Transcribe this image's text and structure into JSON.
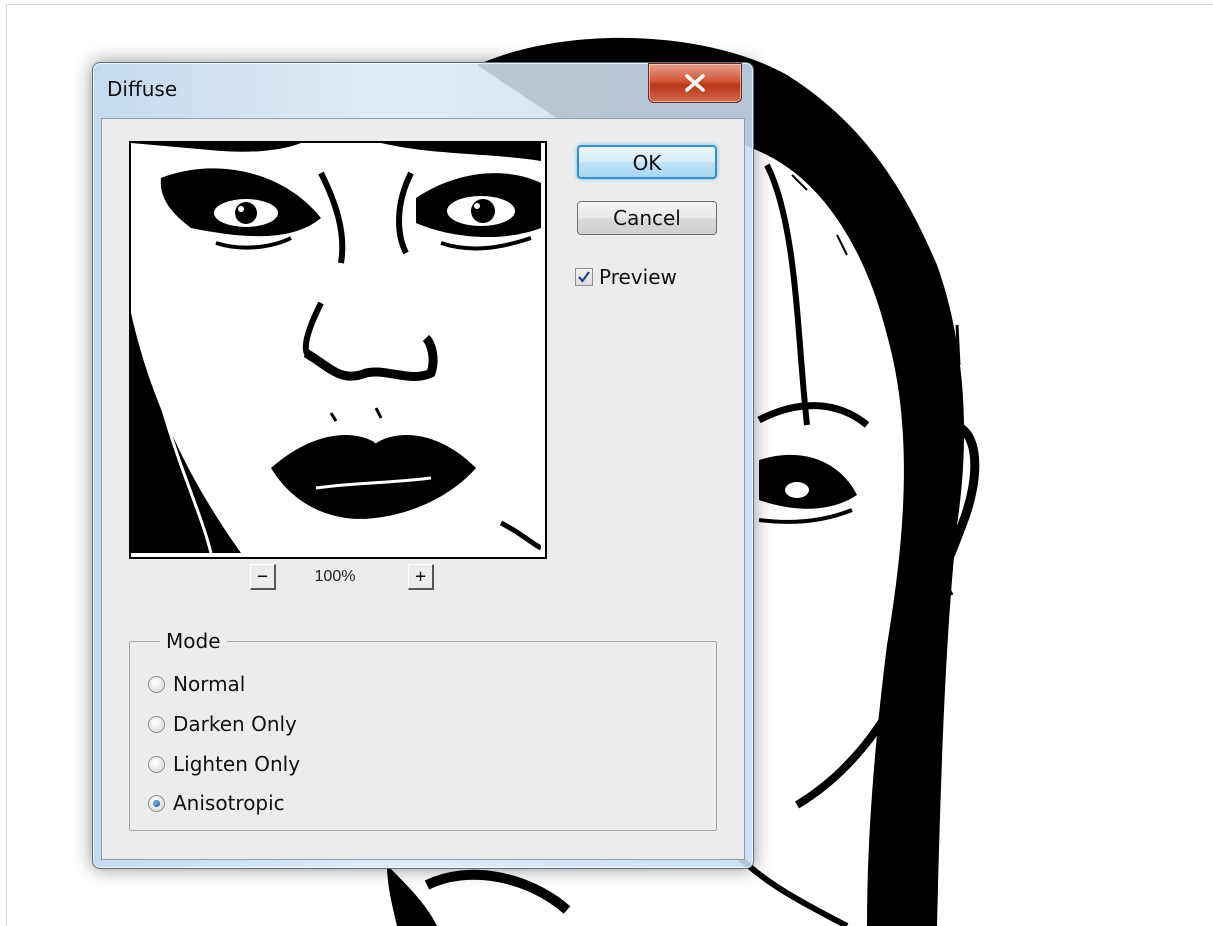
{
  "dialog": {
    "title": "Diffuse",
    "ok_label": "OK",
    "cancel_label": "Cancel",
    "preview_label": "Preview",
    "preview_checked": true,
    "zoom": {
      "minus_label": "−",
      "plus_label": "+",
      "level": "100%"
    },
    "mode": {
      "legend": "Mode",
      "options": [
        {
          "label": "Normal",
          "selected": false
        },
        {
          "label": "Darken Only",
          "selected": false
        },
        {
          "label": "Lighten Only",
          "selected": false
        },
        {
          "label": "Anisotropic",
          "selected": true
        }
      ]
    }
  },
  "colors": {
    "ok_border": "#3a8fc7",
    "close_button": "#c9452a",
    "dialog_glass": "#c9def2"
  },
  "icons": {
    "close": "close-x-icon",
    "check": "checkmark-icon"
  }
}
